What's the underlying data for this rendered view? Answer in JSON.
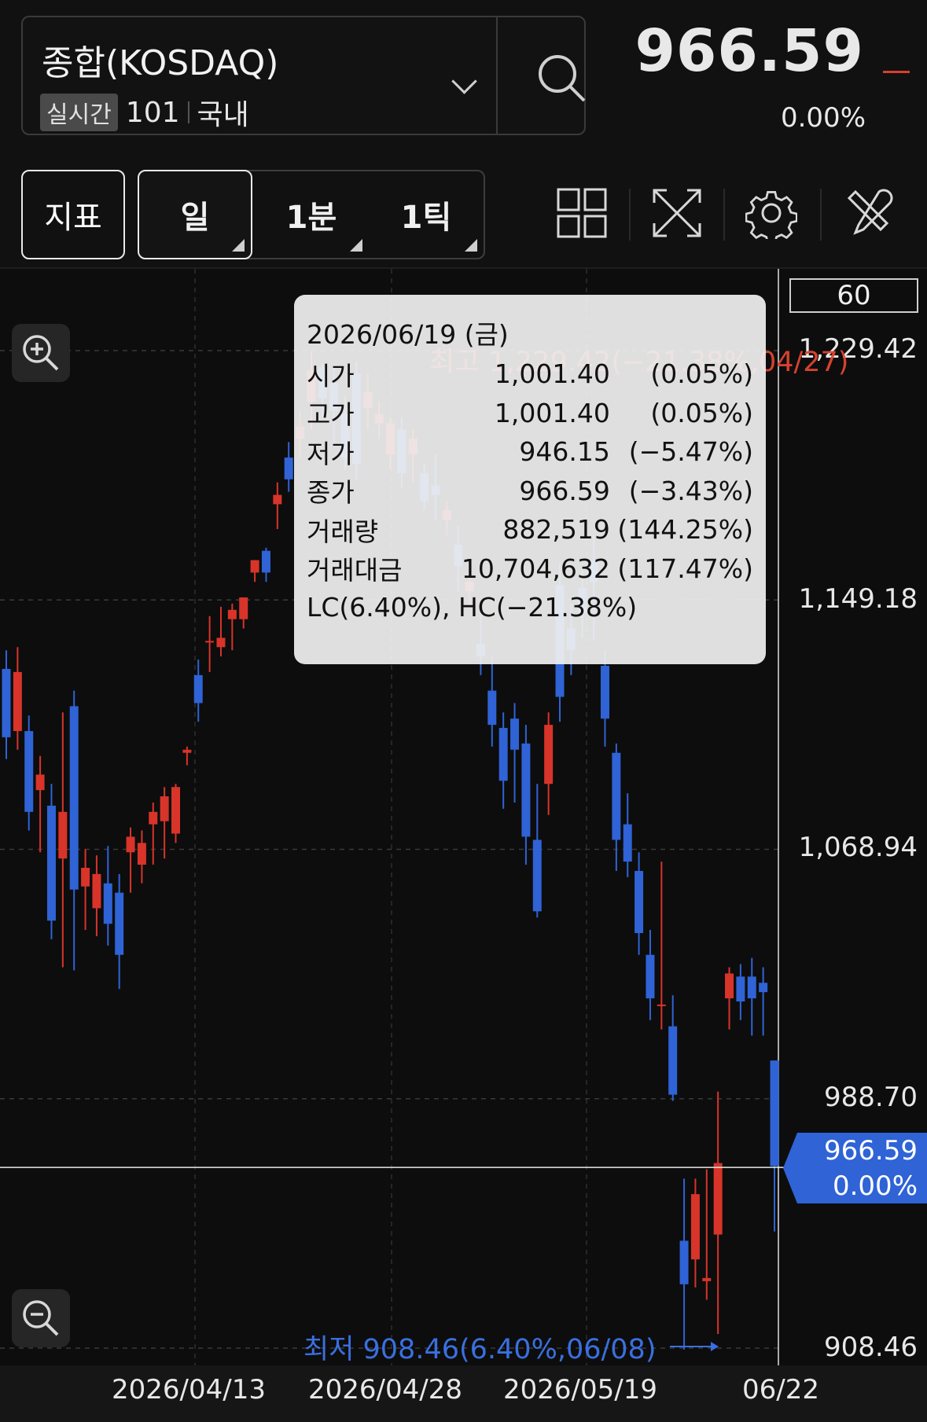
{
  "header": {
    "symbol": "종합(KOSDAQ)",
    "realtime_badge": "실시간",
    "code": "101",
    "market": "국내",
    "price": "966.59",
    "change": "0.00%"
  },
  "toolbar": {
    "indicator_label": "지표",
    "periods": [
      "일",
      "1분",
      "1틱"
    ],
    "icons": [
      "grid-layout-icon",
      "fullscreen-icon",
      "gear-icon",
      "tools-icon"
    ]
  },
  "chart_data": {
    "type": "candlestick",
    "period_label": "60",
    "y_ticks": [
      "1,229.42",
      "1,149.18",
      "1,068.94",
      "988.70",
      "908.46"
    ],
    "x_ticks": [
      "2026/04/13",
      "2026/04/28",
      "2026/05/19",
      "06/22"
    ],
    "ylim": [
      908.46,
      1229.42
    ],
    "high_label": "최고 1,229.42(−21.38%,04/27)",
    "low_label": "최저 908.46(6.40%,06/08)",
    "current_tag": {
      "price": "966.59",
      "change": "0.00%"
    },
    "tooltip": {
      "date": "2026/06/19 (금)",
      "rows": [
        {
          "label": "시가",
          "value": "1,001.40",
          "pct": "(0.05%)"
        },
        {
          "label": "고가",
          "value": "1,001.40",
          "pct": "(0.05%)"
        },
        {
          "label": "저가",
          "value": "946.15",
          "pct": "(−5.47%)"
        },
        {
          "label": "종가",
          "value": "966.59",
          "pct": "(−3.43%)"
        },
        {
          "label": "거래량",
          "value": "882,519",
          "pct": "(144.25%)"
        },
        {
          "label": "거래대금",
          "value": "10,704,632",
          "pct": "(117.47%)"
        }
      ],
      "footer": "LC(6.40%), HC(−21.38%)"
    },
    "candles": [
      {
        "o": 1127,
        "h": 1133,
        "l": 1098,
        "c": 1105
      },
      {
        "o": 1107,
        "h": 1134,
        "l": 1101,
        "c": 1126
      },
      {
        "o": 1107,
        "h": 1112,
        "l": 1075,
        "c": 1081
      },
      {
        "o": 1088,
        "h": 1099,
        "l": 1068,
        "c": 1093
      },
      {
        "o": 1083,
        "h": 1090,
        "l": 1040,
        "c": 1046
      },
      {
        "o": 1066,
        "h": 1113,
        "l": 1031,
        "c": 1081
      },
      {
        "o": 1115,
        "h": 1120,
        "l": 1030,
        "c": 1056
      },
      {
        "o": 1057,
        "h": 1069,
        "l": 1043,
        "c": 1063
      },
      {
        "o": 1050,
        "h": 1067,
        "l": 1041,
        "c": 1061
      },
      {
        "o": 1058,
        "h": 1070,
        "l": 1038,
        "c": 1045
      },
      {
        "o": 1055,
        "h": 1061,
        "l": 1024,
        "c": 1035
      },
      {
        "o": 1068,
        "h": 1076,
        "l": 1055,
        "c": 1073
      },
      {
        "o": 1064,
        "h": 1075,
        "l": 1058,
        "c": 1071
      },
      {
        "o": 1077,
        "h": 1084,
        "l": 1064,
        "c": 1081
      },
      {
        "o": 1078,
        "h": 1089,
        "l": 1066,
        "c": 1086
      },
      {
        "o": 1074,
        "h": 1090,
        "l": 1071,
        "c": 1089
      },
      {
        "o": 1100,
        "h": 1102,
        "l": 1096,
        "c": 1101
      },
      {
        "o": 1125,
        "h": 1130,
        "l": 1110,
        "c": 1116
      },
      {
        "o": 1136,
        "h": 1144,
        "l": 1126,
        "c": 1136
      },
      {
        "o": 1134,
        "h": 1147,
        "l": 1131,
        "c": 1137
      },
      {
        "o": 1143,
        "h": 1148,
        "l": 1133,
        "c": 1146
      },
      {
        "o": 1143,
        "h": 1150,
        "l": 1140,
        "c": 1150
      },
      {
        "o": 1158,
        "h": 1162,
        "l": 1155,
        "c": 1162
      },
      {
        "o": 1165,
        "h": 1166,
        "l": 1155,
        "c": 1158
      },
      {
        "o": 1180,
        "h": 1187,
        "l": 1172,
        "c": 1183
      },
      {
        "o": 1195,
        "h": 1200,
        "l": 1184,
        "c": 1188
      },
      {
        "o": 1201,
        "h": 1210,
        "l": 1195,
        "c": 1205
      },
      {
        "o": 1213,
        "h": 1229,
        "l": 1204,
        "c": 1223
      },
      {
        "o": 1224,
        "h": 1225,
        "l": 1208,
        "c": 1214
      },
      {
        "o": 1219,
        "h": 1225,
        "l": 1199,
        "c": 1210
      },
      {
        "o": 1209,
        "h": 1215,
        "l": 1191,
        "c": 1195
      },
      {
        "o": 1222,
        "h": 1226,
        "l": 1188,
        "c": 1193
      },
      {
        "o": 1211,
        "h": 1222,
        "l": 1204,
        "c": 1216
      },
      {
        "o": 1206,
        "h": 1213,
        "l": 1201,
        "c": 1209
      },
      {
        "o": 1196,
        "h": 1208,
        "l": 1191,
        "c": 1206
      },
      {
        "o": 1204,
        "h": 1208,
        "l": 1185,
        "c": 1190
      },
      {
        "o": 1196,
        "h": 1204,
        "l": 1187,
        "c": 1201
      },
      {
        "o": 1190,
        "h": 1193,
        "l": 1178,
        "c": 1181
      },
      {
        "o": 1186,
        "h": 1196,
        "l": 1175,
        "c": 1183
      },
      {
        "o": 1175,
        "h": 1181,
        "l": 1170,
        "c": 1178
      },
      {
        "o": 1167,
        "h": 1173,
        "l": 1152,
        "c": 1160
      },
      {
        "o": 1152,
        "h": 1157,
        "l": 1147,
        "c": 1155
      },
      {
        "o": 1135,
        "h": 1146,
        "l": 1125,
        "c": 1131
      },
      {
        "o": 1120,
        "h": 1131,
        "l": 1102,
        "c": 1109
      },
      {
        "o": 1108,
        "h": 1113,
        "l": 1082,
        "c": 1091
      },
      {
        "o": 1111,
        "h": 1116,
        "l": 1084,
        "c": 1101
      },
      {
        "o": 1103,
        "h": 1109,
        "l": 1064,
        "c": 1073
      },
      {
        "o": 1072,
        "h": 1090,
        "l": 1047,
        "c": 1049
      },
      {
        "o": 1090,
        "h": 1113,
        "l": 1080,
        "c": 1109
      },
      {
        "o": 1154,
        "h": 1161,
        "l": 1110,
        "c": 1118
      },
      {
        "o": 1140,
        "h": 1148,
        "l": 1125,
        "c": 1133
      },
      {
        "o": 1153,
        "h": 1160,
        "l": 1137,
        "c": 1145
      },
      {
        "o": 1162,
        "h": 1170,
        "l": 1136,
        "c": 1155
      },
      {
        "o": 1128,
        "h": 1133,
        "l": 1102,
        "c": 1111
      },
      {
        "o": 1100,
        "h": 1103,
        "l": 1062,
        "c": 1072
      },
      {
        "o": 1077,
        "h": 1087,
        "l": 1060,
        "c": 1065
      },
      {
        "o": 1062,
        "h": 1068,
        "l": 1035,
        "c": 1042
      },
      {
        "o": 1035,
        "h": 1043,
        "l": 1014,
        "c": 1021
      },
      {
        "o": 1019,
        "h": 1065,
        "l": 1011,
        "c": 1019
      },
      {
        "o": 1012,
        "h": 1022,
        "l": 988,
        "c": 990
      },
      {
        "o": 943,
        "h": 963,
        "l": 908,
        "c": 929
      },
      {
        "o": 937,
        "h": 963,
        "l": 928,
        "c": 958
      },
      {
        "o": 930,
        "h": 966,
        "l": 924,
        "c": 931
      },
      {
        "o": 945,
        "h": 991,
        "l": 913,
        "c": 968
      },
      {
        "o": 1021,
        "h": 1031,
        "l": 1011,
        "c": 1029
      },
      {
        "o": 1028,
        "h": 1032,
        "l": 1014,
        "c": 1020
      },
      {
        "o": 1028,
        "h": 1034,
        "l": 1009,
        "c": 1021
      },
      {
        "o": 1026,
        "h": 1031,
        "l": 1009,
        "c": 1023
      },
      {
        "o": 1001,
        "h": 1001,
        "l": 946,
        "c": 967
      }
    ]
  }
}
